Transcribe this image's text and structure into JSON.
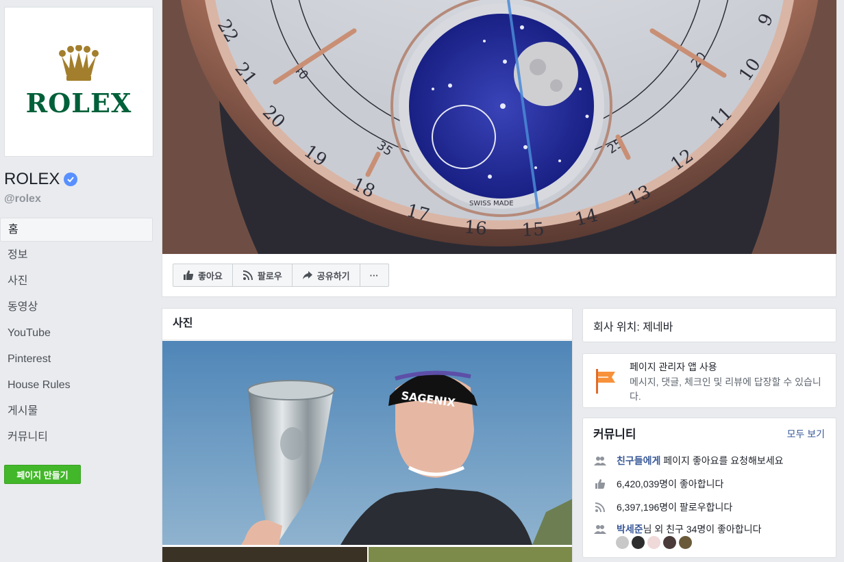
{
  "page": {
    "brand_logo_text": "ROLEX",
    "name": "ROLEX",
    "handle": "@rolex"
  },
  "nav": {
    "items": [
      {
        "label": "홈",
        "active": true
      },
      {
        "label": "정보"
      },
      {
        "label": "사진"
      },
      {
        "label": "동영상"
      },
      {
        "label": "YouTube"
      },
      {
        "label": "Pinterest"
      },
      {
        "label": "House Rules"
      },
      {
        "label": "게시물"
      },
      {
        "label": "커뮤니티"
      }
    ],
    "create_page_label": "페이지 만들기"
  },
  "cover": {
    "dial_numbers": [
      "22",
      "21",
      "20",
      "19",
      "18",
      "17",
      "16",
      "15",
      "14",
      "13",
      "12",
      "11",
      "10",
      "9"
    ],
    "inner_numbers": [
      "40",
      "35",
      "25",
      "20"
    ],
    "dial_text": "SWISS MADE"
  },
  "actions": {
    "like_label": "좋아요",
    "follow_label": "팔로우",
    "share_label": "공유하기",
    "more_label": "···"
  },
  "photos": {
    "title": "사진",
    "cap_text": "SAGENIX"
  },
  "location": {
    "text": "회사 위치: 제네바"
  },
  "manager": {
    "title": "페이지 관리자 앱 사용",
    "description": "메시지, 댓글, 체크인 및 리뷰에 답장할 수 있습니다."
  },
  "community": {
    "title": "커뮤니티",
    "see_all": "모두 보기",
    "invite_link": "친구들에게",
    "invite_rest": " 페이지 좋아요를 요청해보세요",
    "likes": "6,420,039명이 좋아합니다",
    "follows": "6,397,196명이 팔로우합니다",
    "friend_link": "박세준",
    "friend_rest": "님 외 친구 34명이 좋아합니다"
  },
  "colors": {
    "rolex_green": "#006039",
    "crown_gold": "#a37e2c",
    "fb_blue": "#385898",
    "create_green": "#42b72a",
    "bg_gray": "#e9ebee"
  }
}
